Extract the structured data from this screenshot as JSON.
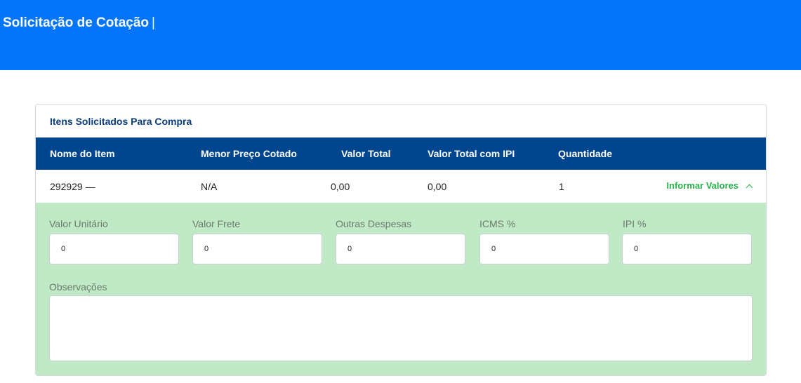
{
  "header": {
    "title": "Solicitação de Cotação",
    "separator": "|"
  },
  "card": {
    "title": "Itens Solicitados Para Compra"
  },
  "table": {
    "columns": [
      "Nome do Item",
      "Menor Preço Cotado",
      "Valor Total",
      "Valor Total com IPI",
      "Quantidade"
    ],
    "rows": [
      {
        "nome": "292929 —",
        "menor_preco": "N/A",
        "valor_total": "0,00",
        "valor_total_ipi": "0,00",
        "quantidade": "1",
        "toggle_label": "Informar Valores"
      }
    ]
  },
  "detail": {
    "fields": [
      {
        "label": "Valor Unitário",
        "value": "0"
      },
      {
        "label": "Valor Frete",
        "value": "0"
      },
      {
        "label": "Outras Despesas",
        "value": "0"
      },
      {
        "label": "ICMS %",
        "value": "0"
      },
      {
        "label": "IPI %",
        "value": "0"
      }
    ],
    "observacoes_label": "Observações",
    "observacoes_value": ""
  },
  "colors": {
    "header_bg": "#0275fb",
    "table_header_bg": "#00468f",
    "detail_bg": "#bfeac5",
    "accent_green": "#27b24a"
  }
}
